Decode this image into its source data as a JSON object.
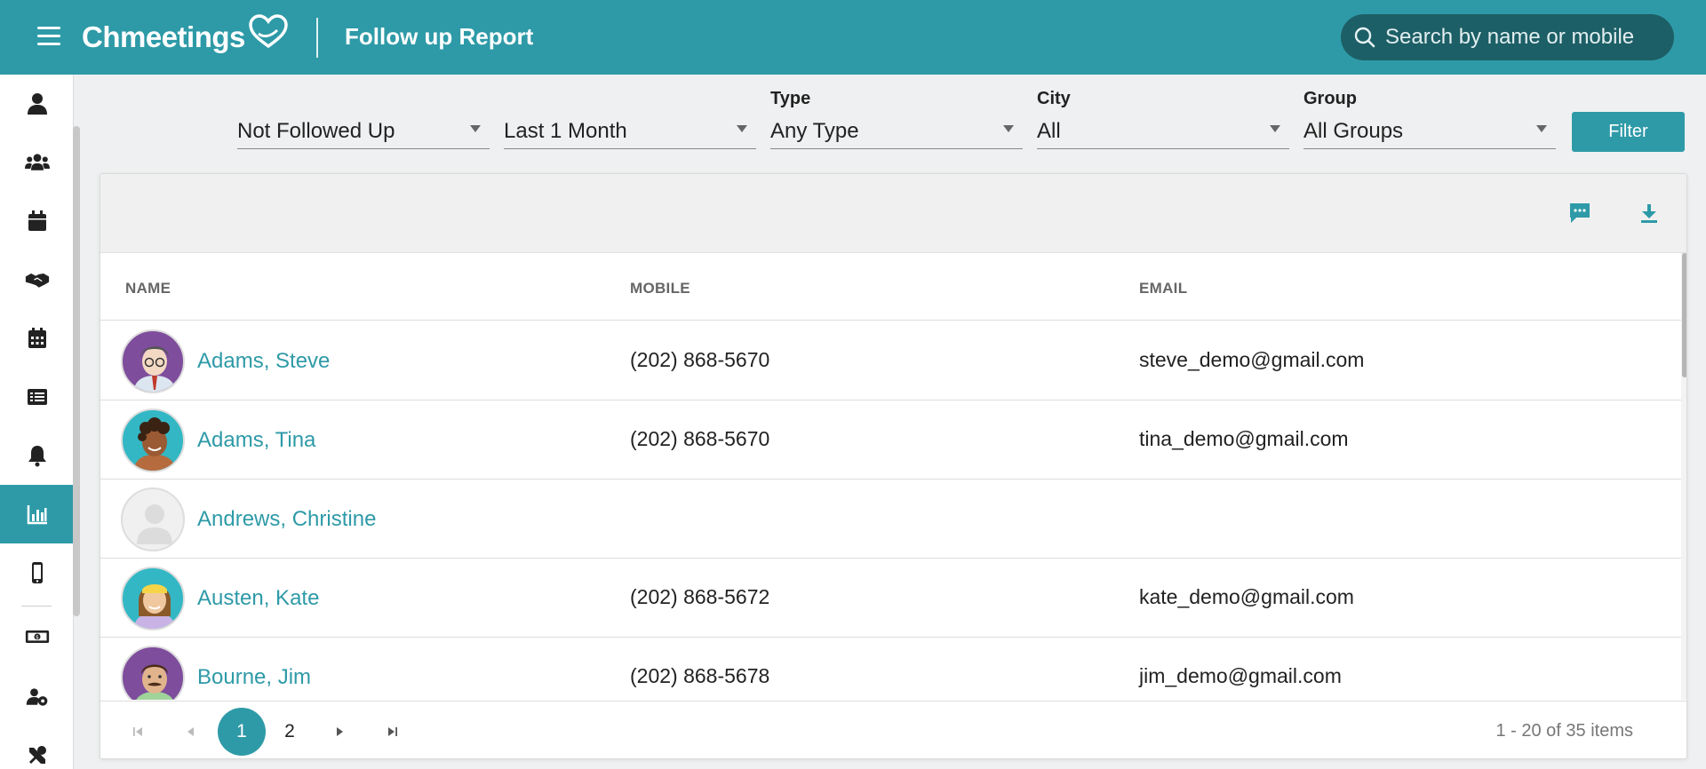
{
  "header": {
    "app_name": "Chmeetings",
    "page_title": "Follow up Report",
    "search_placeholder": "Search by name or mobile"
  },
  "sidebar": {
    "items": [
      {
        "name": "person-icon"
      },
      {
        "name": "people-icon"
      },
      {
        "name": "calendar-icon"
      },
      {
        "name": "handshake-icon"
      },
      {
        "name": "calendar-grid-icon"
      },
      {
        "name": "list-icon"
      },
      {
        "name": "bell-icon"
      },
      {
        "name": "bar-chart-icon",
        "active": true
      },
      {
        "name": "mobile-icon"
      },
      {
        "name": "money-icon"
      },
      {
        "name": "users-gear-icon"
      },
      {
        "name": "tools-icon"
      }
    ]
  },
  "filters": {
    "status": {
      "label": "",
      "value": "Not Followed Up"
    },
    "period": {
      "label": "",
      "value": "Last 1 Month"
    },
    "type": {
      "label": "Type",
      "value": "Any Type"
    },
    "city": {
      "label": "City",
      "value": "All"
    },
    "group": {
      "label": "Group",
      "value": "All Groups"
    },
    "filter_button": "Filter"
  },
  "table": {
    "columns": {
      "name": "NAME",
      "mobile": "MOBILE",
      "email": "EMAIL"
    },
    "rows": [
      {
        "name": "Adams, Steve",
        "mobile": "(202) 868-5670",
        "email": "steve_demo@gmail.com",
        "avatar": "man-glasses-avatar"
      },
      {
        "name": "Adams, Tina",
        "mobile": "(202) 868-5670",
        "email": "tina_demo@gmail.com",
        "avatar": "woman-curly-avatar"
      },
      {
        "name": "Andrews, Christine",
        "mobile": "",
        "email": "",
        "avatar": "placeholder-avatar"
      },
      {
        "name": "Austen, Kate",
        "mobile": "(202) 868-5672",
        "email": "kate_demo@gmail.com",
        "avatar": "woman-blonde-avatar"
      },
      {
        "name": "Bourne, Jim",
        "mobile": "(202) 868-5678",
        "email": "jim_demo@gmail.com",
        "avatar": "man-mustache-avatar"
      }
    ]
  },
  "pagination": {
    "pages": [
      "1",
      "2"
    ],
    "current": "1",
    "info": "1 - 20 of 35 items"
  },
  "colors": {
    "primary": "#2e9aa7",
    "search_bg": "#1d5f66",
    "link": "#2e9aa7"
  }
}
